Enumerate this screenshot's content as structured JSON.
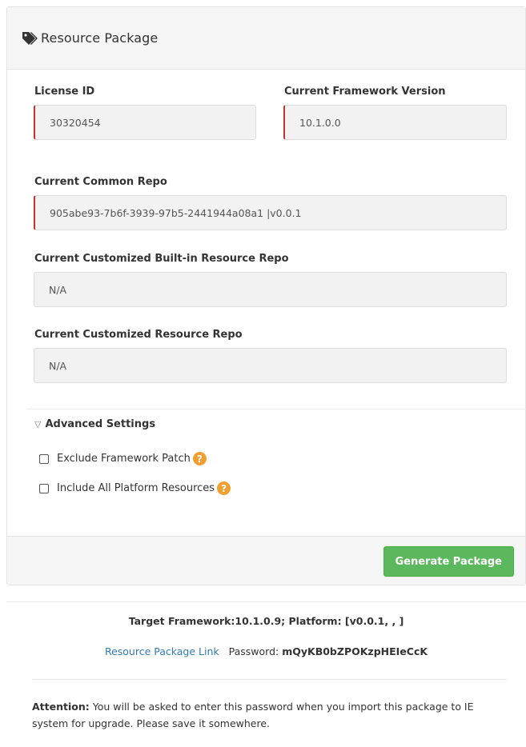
{
  "header": {
    "icon": "tags-icon",
    "title": "Resource Package"
  },
  "fields": {
    "license_id": {
      "label": "License ID",
      "value": "30320454"
    },
    "framework_version": {
      "label": "Current Framework Version",
      "value": "10.1.0.0"
    },
    "common_repo": {
      "label": "Current Common Repo",
      "value": "905abe93-7b6f-3939-97b5-2441944a08a1 |v0.0.1"
    },
    "builtin_repo": {
      "label": "Current Customized Built-in Resource Repo",
      "value": "N/A"
    },
    "custom_repo": {
      "label": "Current Customized Resource Repo",
      "value": "N/A"
    }
  },
  "advanced": {
    "toggle_label": "Advanced Settings",
    "toggle_icon": "triangle-down-icon",
    "options": [
      {
        "label": "Exclude Framework Patch",
        "checked": false
      },
      {
        "label": "Include All Platform Resources",
        "checked": false
      }
    ],
    "help_icon": "question-icon",
    "help_glyph": "?"
  },
  "footer": {
    "generate_label": "Generate Package"
  },
  "result": {
    "target_text": "Target Framework:10.1.0.9; Platform: [v0.0.1, , ]",
    "link_label": "Resource Package Link",
    "password_label": "Password:",
    "password_value": "mQyKB0bZPOKzpHEIeCcK",
    "attention_title": "Attention:",
    "attention_text": "You will be asked to enter this password when you import this package to IE system for upgrade. Please save it somewhere."
  },
  "colors": {
    "invalid_border": "#c9302c",
    "button_green": "#5cb85c",
    "link_blue": "#337ab7",
    "help_orange": "#f0a030"
  }
}
